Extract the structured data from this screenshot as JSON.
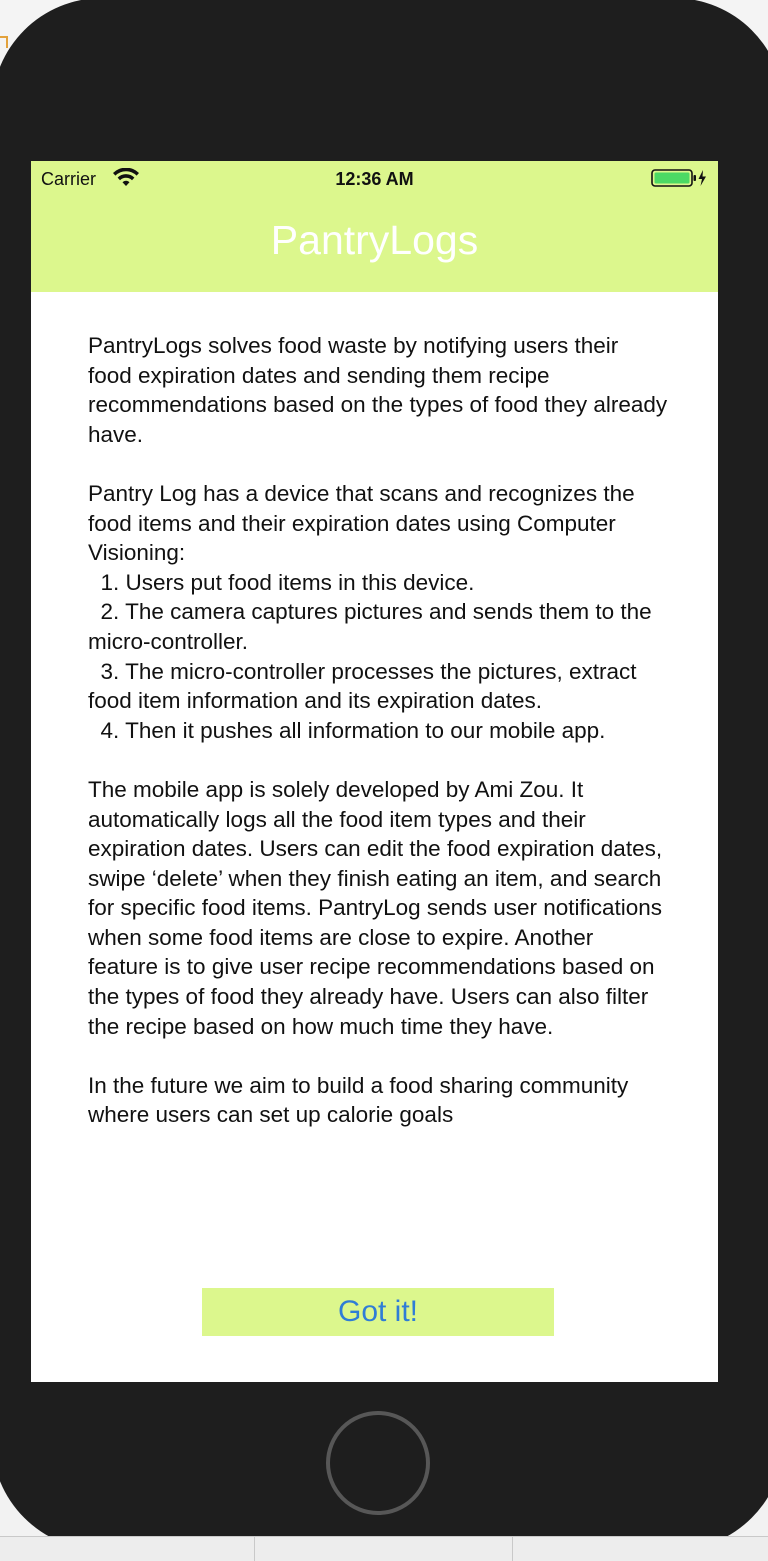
{
  "status_bar": {
    "carrier": "Carrier",
    "time": "12:36 AM",
    "icons": [
      "wifi-icon",
      "battery-icon",
      "charging-bolt-icon"
    ]
  },
  "nav": {
    "title": "PantryLogs"
  },
  "content": {
    "about_text": "PantryLogs solves food waste by notifying users their food expiration dates and sending them recipe recommendations based on the types of food they already have.\n\nPantry Log has a device that scans and recognizes the food items and their expiration dates using Computer Visioning:\n  1. Users put food items in this device.\n  2. The camera captures pictures and sends them to the micro-controller.\n  3. The micro-controller processes the pictures, extract food item information and its expiration dates.\n  4. Then it pushes all information to our mobile app.\n\nThe mobile app is solely developed by Ami Zou. It automatically logs all the food item types and their expiration dates. Users can edit the food expiration dates, swipe ‘delete’ when they finish eating an item, and search for specific food items. PantryLog sends user notifications when some food items are close to expire. Another feature is to give user recipe recommendations based on the types of food they already have. Users can also filter the recipe based on how much time they have.\n\nIn the future we aim to build a food sharing community where users can set up calorie goals"
  },
  "actions": {
    "got_it_label": "Got it!"
  },
  "colors": {
    "accent_green": "#dcf78d",
    "button_text_blue": "#2f7dd6",
    "device_body": "#1e1e1e"
  }
}
